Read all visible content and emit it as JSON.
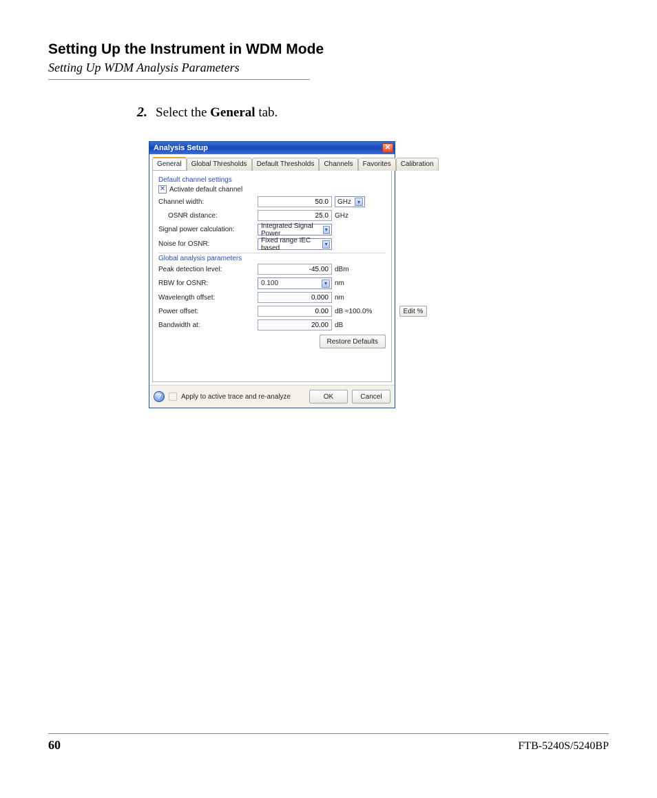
{
  "page": {
    "title": "Setting Up the Instrument in WDM Mode",
    "subtitle": "Setting Up WDM Analysis Parameters",
    "number": "60",
    "doc_id": "FTB-5240S/5240BP"
  },
  "step": {
    "number": "2.",
    "prefix": "Select the ",
    "bold": "General",
    "suffix": " tab."
  },
  "dialog": {
    "title": "Analysis Setup",
    "tabs": [
      "General",
      "Global Thresholds",
      "Default Thresholds",
      "Channels",
      "Favorites",
      "Calibration"
    ],
    "group1": "Default channel settings",
    "activate_label": "Activate default channel",
    "channel_width": {
      "label": "Channel width:",
      "value": "50.0",
      "unit": "GHz"
    },
    "osnr_distance": {
      "label": "OSNR distance:",
      "value": "25.0",
      "unit": "GHz"
    },
    "signal_power": {
      "label": "Signal power calculation:",
      "value": "Integrated Signal Power"
    },
    "noise_osnr": {
      "label": "Noise for OSNR:",
      "value": "Fixed range IEC based"
    },
    "group2": "Global analysis parameters",
    "peak": {
      "label": "Peak detection level:",
      "value": "-45.00",
      "unit": "dBm"
    },
    "rbw": {
      "label": "RBW for OSNR:",
      "value": "0.100",
      "unit": "nm"
    },
    "wloff": {
      "label": "Wavelength offset:",
      "value": "0.000",
      "unit": "nm"
    },
    "poff": {
      "label": "Power offset:",
      "value": "0.00",
      "unit": "dB",
      "pct": "≈100.0%",
      "edit": "Edit %"
    },
    "bw": {
      "label": "Bandwidth at:",
      "value": "20.00",
      "unit": "dB"
    },
    "restore": "Restore Defaults",
    "apply": "Apply to active trace and re-analyze",
    "ok": "OK",
    "cancel": "Cancel"
  }
}
